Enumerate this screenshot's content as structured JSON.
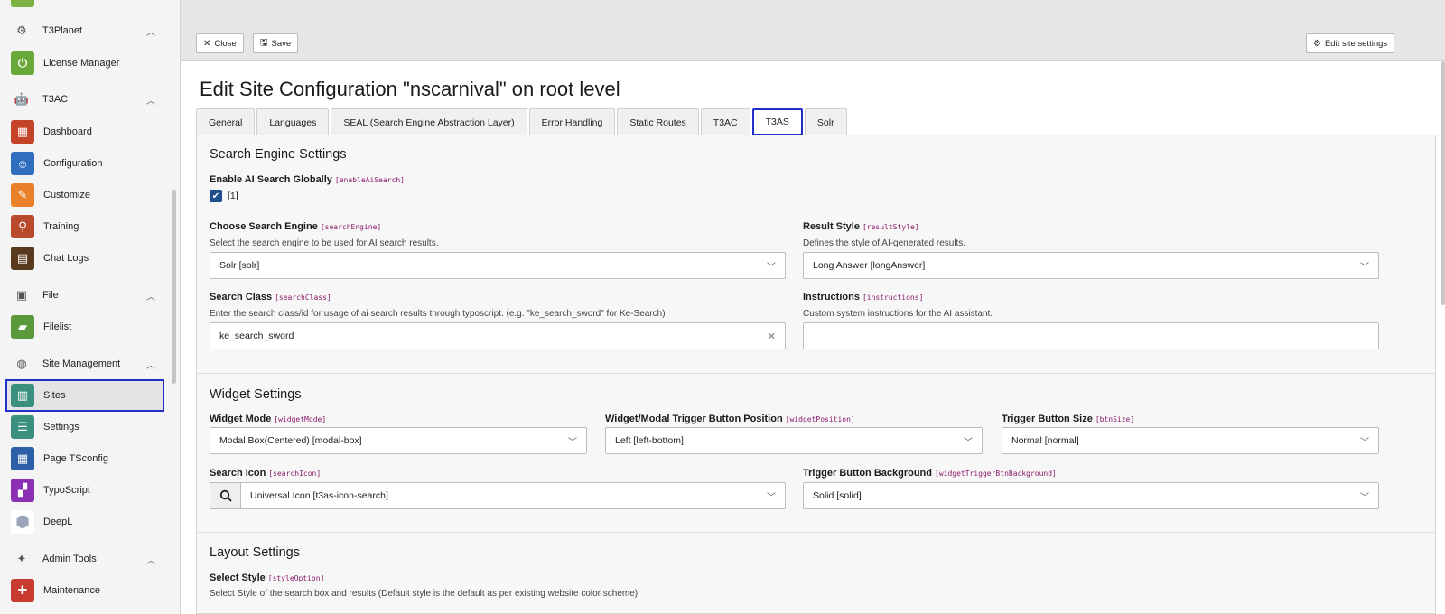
{
  "sidebar": {
    "groups": {
      "t3planet": "T3Planet",
      "t3ac": "T3AC",
      "file": "File",
      "site_management": "Site Management",
      "admin_tools": "Admin Tools"
    },
    "modules": {
      "license_manager": "License Manager",
      "dashboard": "Dashboard",
      "configuration": "Configuration",
      "customize": "Customize",
      "training": "Training",
      "chat_logs": "Chat Logs",
      "filelist": "Filelist",
      "sites": "Sites",
      "settings": "Settings",
      "page_tsconfig": "Page TSconfig",
      "typoscript": "TypoScript",
      "deepl": "DeepL",
      "maintenance": "Maintenance"
    }
  },
  "toolbar": {
    "close_label": "Close",
    "save_label": "Save",
    "edit_site_settings_label": "Edit site settings"
  },
  "page": {
    "title": "Edit Site Configuration \"nscarnival\" on root level"
  },
  "tabs": [
    "General",
    "Languages",
    "SEAL (Search Engine Abstraction Layer)",
    "Error Handling",
    "Static Routes",
    "T3AC",
    "T3AS",
    "Solr"
  ],
  "search_engine_settings": {
    "title": "Search Engine Settings",
    "enable_ai": {
      "label": "Enable AI Search Globally",
      "key": "[enableAiSearch]",
      "value": "[1]"
    },
    "search_engine": {
      "label": "Choose Search Engine",
      "key": "[searchEngine]",
      "desc": "Select the search engine to be used for AI search results.",
      "value": "Solr [solr]"
    },
    "result_style": {
      "label": "Result Style",
      "key": "[resultStyle]",
      "desc": "Defines the style of AI-generated results.",
      "value": "Long Answer [longAnswer]"
    },
    "search_class": {
      "label": "Search Class",
      "key": "[searchClass]",
      "desc": "Enter the search class/id for usage of ai search results through typoscript. (e.g. \"ke_search_sword\" for Ke-Search)",
      "value": "ke_search_sword"
    },
    "instructions": {
      "label": "Instructions",
      "key": "[instructions]",
      "desc": "Custom system instructions for the AI assistant.",
      "value": ""
    }
  },
  "widget_settings": {
    "title": "Widget Settings",
    "widget_mode": {
      "label": "Widget Mode",
      "key": "[widgetMode]",
      "value": "Modal Box(Centered) [modal-box]"
    },
    "widget_position": {
      "label": "Widget/Modal Trigger Button Position",
      "key": "[widgetPosition]",
      "value": "Left [left-bottom]"
    },
    "btn_size": {
      "label": "Trigger Button Size",
      "key": "[btnSize]",
      "value": "Normal [normal]"
    },
    "search_icon": {
      "label": "Search Icon",
      "key": "[searchIcon]",
      "value": "Universal Icon [t3as-icon-search]"
    },
    "trigger_bg": {
      "label": "Trigger Button Background",
      "key": "[widgetTriggerBtnBackground]",
      "value": "Solid [solid]"
    }
  },
  "layout_settings": {
    "title": "Layout Settings",
    "style_option": {
      "label": "Select Style",
      "key": "[styleOption]",
      "desc": "Select Style of the search box and results (Default style is the default as per existing website color scheme)"
    }
  }
}
